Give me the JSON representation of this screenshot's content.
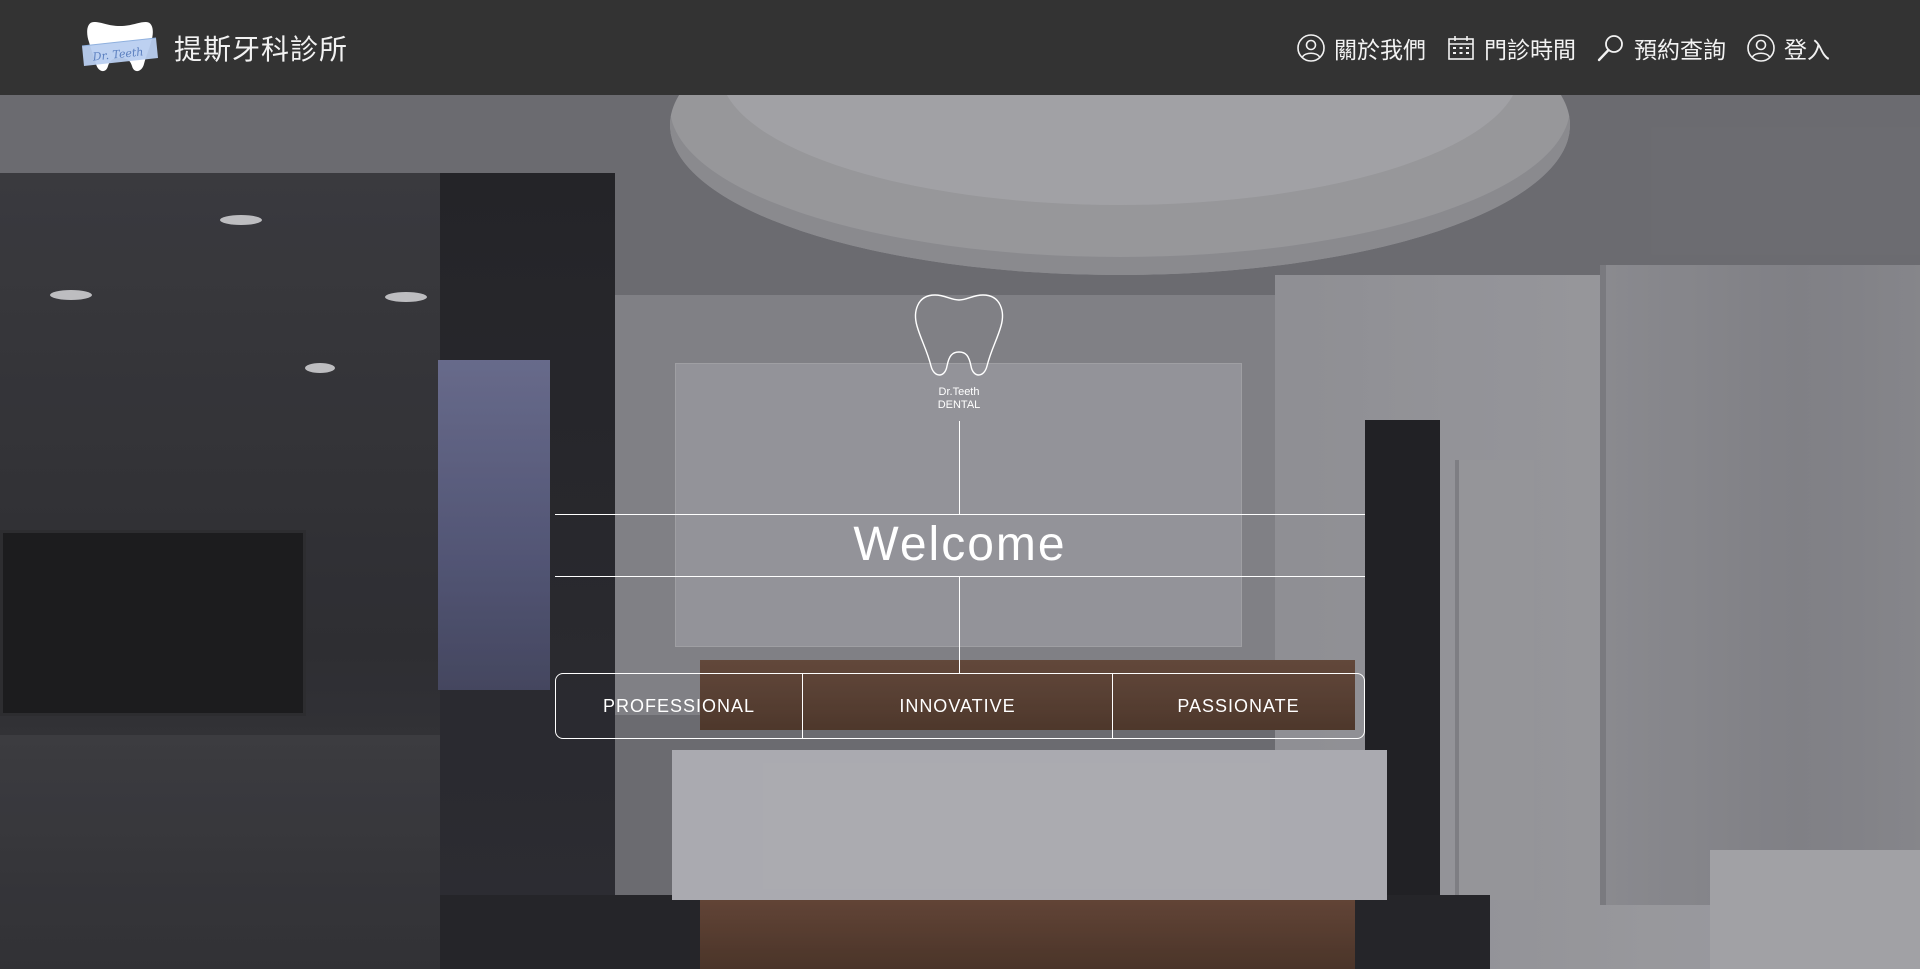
{
  "header": {
    "brand_name": "提斯牙科診所",
    "logo_text": "Dr. Teeth",
    "nav": [
      {
        "label": "關於我們",
        "icon": "user-icon"
      },
      {
        "label": "門診時間",
        "icon": "calendar-icon"
      },
      {
        "label": "預約查詢",
        "icon": "search-icon"
      },
      {
        "label": "登入",
        "icon": "user-icon"
      }
    ]
  },
  "hero": {
    "logo_line1": "Dr.Teeth",
    "logo_line2": "DENTAL",
    "welcome": "Welcome",
    "pillars": [
      "PROFESSIONAL",
      "INNOVATIVE",
      "PASSIONATE"
    ]
  },
  "colors": {
    "header_bg": "#333333",
    "text": "#ffffff",
    "logo_ribbon": "#a9c4e6"
  }
}
